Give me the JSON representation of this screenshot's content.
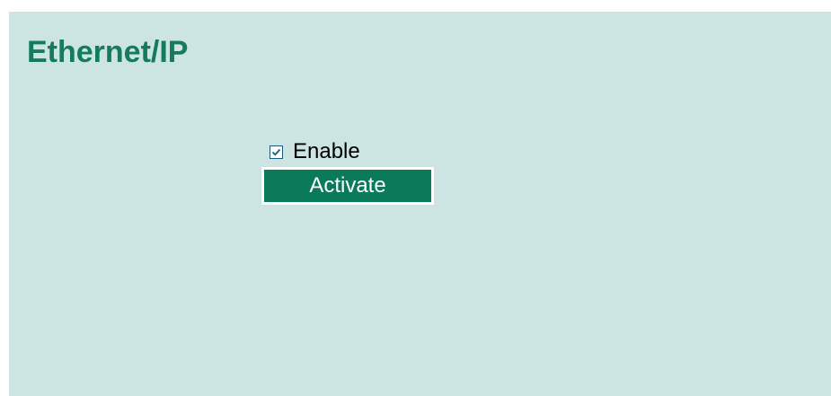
{
  "page": {
    "title": "Ethernet/IP"
  },
  "form": {
    "enable": {
      "label": "Enable",
      "checked": true
    },
    "activate_button": {
      "label": "Activate"
    }
  },
  "colors": {
    "panel_background": "#cce5e3",
    "title_color": "#157a5e",
    "button_background": "#0b7a5a",
    "button_text": "#ffffff"
  },
  "icons": {
    "checkbox_mark": "check-icon"
  }
}
